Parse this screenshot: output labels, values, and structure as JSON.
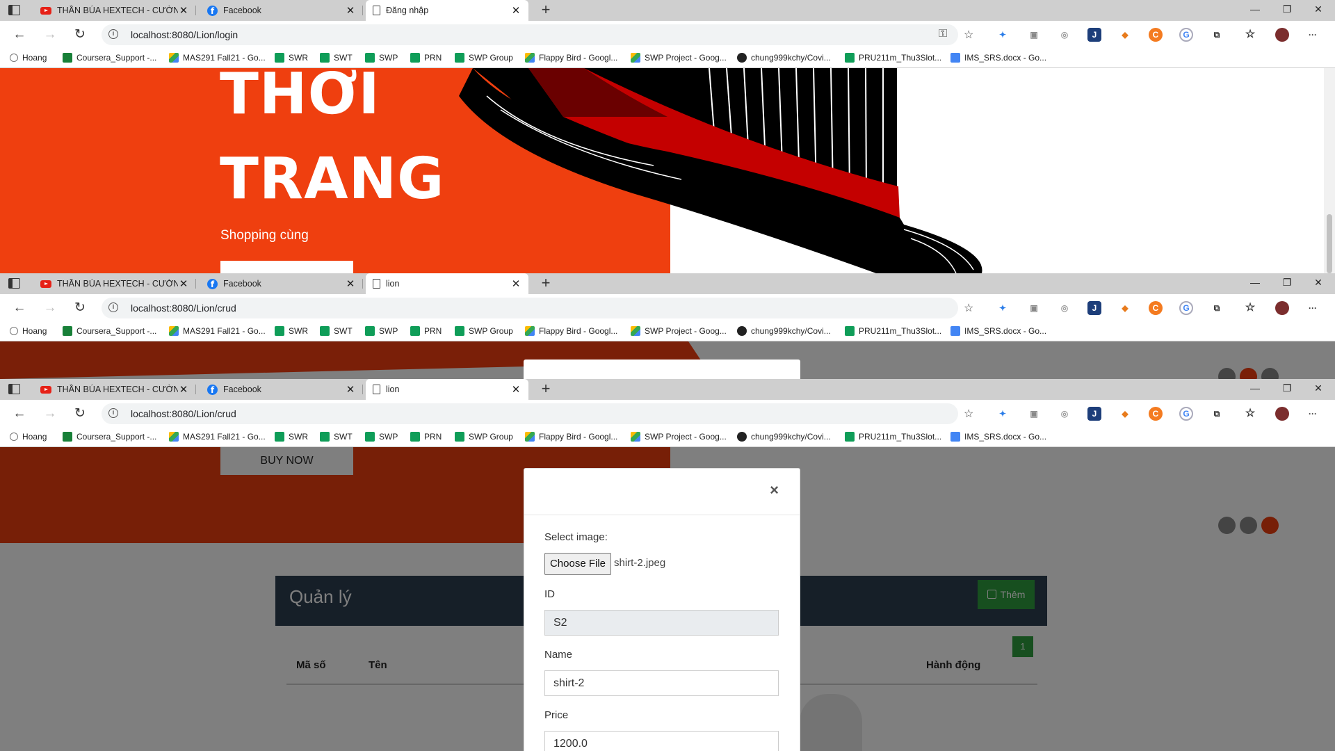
{
  "tabs": [
    {
      "label": "THẦN BÚA HEXTECH - CƯỜNG ĐÔ LA",
      "icon": "youtube-icon"
    },
    {
      "label": "Facebook",
      "icon": "facebook-icon"
    }
  ],
  "windows": [
    {
      "active_tab": "Đăng nhập",
      "url": "localhost:8080/Lion/login"
    },
    {
      "active_tab": "lion",
      "url": "localhost:8080/Lion/crud"
    },
    {
      "active_tab": "lion",
      "url": "localhost:8080/Lion/crud"
    }
  ],
  "bookmarks": [
    "Hoang",
    "Coursera_Support -...",
    "MAS291 Fall21 - Go...",
    "SWR",
    "SWT",
    "SWP",
    "PRN",
    "SWP Group",
    "Flappy Bird - Googl...",
    "SWP Project - Goog...",
    "chung999kchy/Covi...",
    "PRU211m_Thu3Slot...",
    "IMS_SRS.docx - Go..."
  ],
  "hero": {
    "line1": "THỜI",
    "line2": "TRANG",
    "subtitle": "Shopping cùng",
    "buy_button": "BUY NOW"
  },
  "colors": {
    "brand": "#ef3f0f",
    "panel_header": "#2d3e50",
    "add_button": "#2e9e3e"
  },
  "admin": {
    "title": "Quản lý",
    "add_button": "Thêm",
    "page_number": "1",
    "columns": [
      "Mã số",
      "Tên",
      "Hành động"
    ]
  },
  "modal": {
    "close": "×",
    "image_label": "Select image:",
    "file_button": "Choose File",
    "file_name": "shirt-2.jpeg",
    "id_label": "ID",
    "id_value": "S2",
    "name_label": "Name",
    "name_value": "shirt-2",
    "price_label": "Price",
    "price_value": "1200.0"
  }
}
